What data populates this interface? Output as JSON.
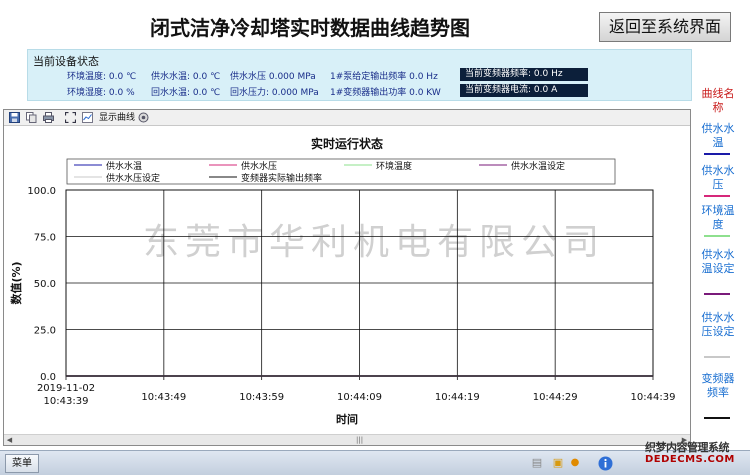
{
  "header": {
    "title": "闭式洁净冷却塔实时数据曲线趋势图",
    "back_button": "返回至系统界面"
  },
  "status": {
    "title": "当前设备状态",
    "row1": [
      "环境温度: 0.0 ℃",
      "供水水温: 0.0 ℃",
      "供水水压 0.000 MPa",
      "1#泵给定输出频率 0.0 Hz"
    ],
    "row2": [
      "环境湿度: 0.0 %",
      "回水水温: 0.0 ℃",
      "回水压力: 0.000 MPa",
      "1#变频器输出功率 0.0 KW"
    ],
    "box1": "当前变频器频率: 0.0 Hz",
    "box2": "当前变频器电流: 0.0 A"
  },
  "sidebar": {
    "header": "曲线名称",
    "items": [
      {
        "label": "供水水温",
        "color": "#1a1aa8"
      },
      {
        "label": "供水水压",
        "color": "#d6287a"
      },
      {
        "label": "环境温度",
        "color": "#8ee08e"
      },
      {
        "label": "供水水温设定",
        "color": "#7a1a7a"
      },
      {
        "label": "供水水压设定",
        "color": "#c8c8c8"
      },
      {
        "label": "变频器频率",
        "color": "#111111"
      }
    ]
  },
  "toolbar": {
    "icons": [
      "save-icon",
      "copy-icon",
      "print-icon",
      "zoom-icon",
      "settings-icon"
    ],
    "show_curve_label": "显示曲线"
  },
  "chart_data": {
    "type": "line",
    "title": "实时运行状态",
    "xlabel": "时间",
    "ylabel": "数值(%)",
    "ylim": [
      0,
      100
    ],
    "yticks": [
      "0.0",
      "25.0",
      "50.0",
      "75.0",
      "100.0"
    ],
    "x": [
      "2019-11-02 10:43:39",
      "10:43:49",
      "10:43:59",
      "10:44:09",
      "10:44:19",
      "10:44:29",
      "10:44:39"
    ],
    "x_first_line1": "2019-11-02",
    "x_first_line2": "10:43:39",
    "series": [
      {
        "name": "供水水温",
        "color": "#1a1aa8",
        "values": [
          0,
          0,
          0,
          0,
          0,
          0,
          0
        ]
      },
      {
        "name": "供水水压",
        "color": "#d6287a",
        "values": [
          0,
          0,
          0,
          0,
          0,
          0,
          0
        ]
      },
      {
        "name": "环境温度",
        "color": "#8ee08e",
        "values": [
          0,
          0,
          0,
          0,
          0,
          0,
          0
        ]
      },
      {
        "name": "供水水温设定",
        "color": "#7a1a7a",
        "values": [
          0,
          0,
          0,
          0,
          0,
          0,
          0
        ]
      },
      {
        "name": "供水水压设定",
        "color": "#c8c8c8",
        "values": [
          0,
          0,
          0,
          0,
          0,
          0,
          0
        ]
      },
      {
        "name": "变频器实际输出频率",
        "color": "#111111",
        "values": [
          0,
          0,
          0,
          0,
          0,
          0,
          0
        ]
      }
    ],
    "grid": true,
    "legend": "top",
    "watermark": "东莞市华利机电有限公司"
  },
  "taskbar": {
    "start_label": "菜单",
    "watermark_text": "织梦内容管理系统",
    "watermark_domain": "DEDECMS.COM"
  }
}
